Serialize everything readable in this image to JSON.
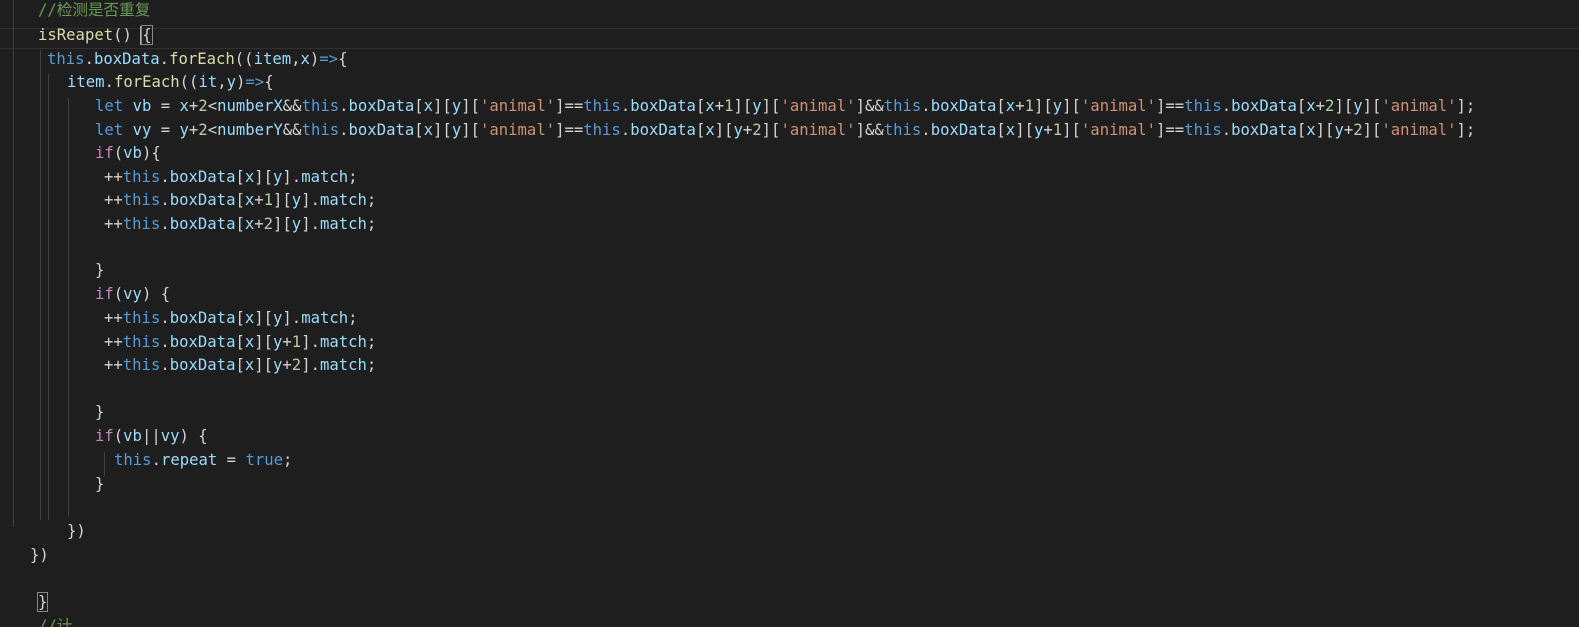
{
  "editor": {
    "lines": [
      {
        "name": "code-line-1",
        "tokens": [
          {
            "c": "cmt",
            "t": "//检测是否重复"
          }
        ]
      },
      {
        "name": "code-line-2",
        "tokens": [
          {
            "c": "fn",
            "t": "isReapet"
          },
          {
            "c": "pun",
            "t": "() "
          },
          {
            "c": "pun bracket-match",
            "t": "{"
          }
        ]
      },
      {
        "name": "code-line-3",
        "tokens": [
          {
            "c": "kw",
            "t": "this"
          },
          {
            "c": "pun",
            "t": "."
          },
          {
            "c": "var",
            "t": "boxData"
          },
          {
            "c": "pun",
            "t": "."
          },
          {
            "c": "fn",
            "t": "forEach"
          },
          {
            "c": "pun",
            "t": "(("
          },
          {
            "c": "var",
            "t": "item"
          },
          {
            "c": "pun",
            "t": ","
          },
          {
            "c": "var",
            "t": "x"
          },
          {
            "c": "pun",
            "t": ")"
          },
          {
            "c": "kw",
            "t": "=>"
          },
          {
            "c": "pun",
            "t": "{"
          }
        ]
      },
      {
        "name": "code-line-4",
        "tokens": [
          {
            "c": "var",
            "t": "item"
          },
          {
            "c": "pun",
            "t": "."
          },
          {
            "c": "fn",
            "t": "forEach"
          },
          {
            "c": "pun",
            "t": "(("
          },
          {
            "c": "var",
            "t": "it"
          },
          {
            "c": "pun",
            "t": ","
          },
          {
            "c": "var",
            "t": "y"
          },
          {
            "c": "pun",
            "t": ")"
          },
          {
            "c": "kw",
            "t": "=>"
          },
          {
            "c": "pun",
            "t": "{"
          }
        ]
      },
      {
        "name": "code-line-5",
        "tokens": [
          {
            "c": "kw",
            "t": "let"
          },
          {
            "c": "pun",
            "t": " "
          },
          {
            "c": "var",
            "t": "vb"
          },
          {
            "c": "pun",
            "t": " = "
          },
          {
            "c": "var",
            "t": "x"
          },
          {
            "c": "pun",
            "t": "+"
          },
          {
            "c": "num",
            "t": "2"
          },
          {
            "c": "pun",
            "t": "<"
          },
          {
            "c": "var",
            "t": "numberX"
          },
          {
            "c": "pun",
            "t": "&&"
          },
          {
            "c": "kw",
            "t": "this"
          },
          {
            "c": "pun",
            "t": "."
          },
          {
            "c": "var",
            "t": "boxData"
          },
          {
            "c": "pun",
            "t": "["
          },
          {
            "c": "var",
            "t": "x"
          },
          {
            "c": "pun",
            "t": "]["
          },
          {
            "c": "var",
            "t": "y"
          },
          {
            "c": "pun",
            "t": "]["
          },
          {
            "c": "str",
            "t": "'animal'"
          },
          {
            "c": "pun",
            "t": "]=="
          },
          {
            "c": "kw",
            "t": "this"
          },
          {
            "c": "pun",
            "t": "."
          },
          {
            "c": "var",
            "t": "boxData"
          },
          {
            "c": "pun",
            "t": "["
          },
          {
            "c": "var",
            "t": "x"
          },
          {
            "c": "pun",
            "t": "+"
          },
          {
            "c": "num",
            "t": "1"
          },
          {
            "c": "pun",
            "t": "]["
          },
          {
            "c": "var",
            "t": "y"
          },
          {
            "c": "pun",
            "t": "]["
          },
          {
            "c": "str",
            "t": "'animal'"
          },
          {
            "c": "pun",
            "t": "]&&"
          },
          {
            "c": "kw",
            "t": "this"
          },
          {
            "c": "pun",
            "t": "."
          },
          {
            "c": "var",
            "t": "boxData"
          },
          {
            "c": "pun",
            "t": "["
          },
          {
            "c": "var",
            "t": "x"
          },
          {
            "c": "pun",
            "t": "+"
          },
          {
            "c": "num",
            "t": "1"
          },
          {
            "c": "pun",
            "t": "]["
          },
          {
            "c": "var",
            "t": "y"
          },
          {
            "c": "pun",
            "t": "]["
          },
          {
            "c": "str",
            "t": "'animal'"
          },
          {
            "c": "pun",
            "t": "]=="
          },
          {
            "c": "kw",
            "t": "this"
          },
          {
            "c": "pun",
            "t": "."
          },
          {
            "c": "var",
            "t": "boxData"
          },
          {
            "c": "pun",
            "t": "["
          },
          {
            "c": "var",
            "t": "x"
          },
          {
            "c": "pun",
            "t": "+"
          },
          {
            "c": "num",
            "t": "2"
          },
          {
            "c": "pun",
            "t": "]["
          },
          {
            "c": "var",
            "t": "y"
          },
          {
            "c": "pun",
            "t": "]["
          },
          {
            "c": "str",
            "t": "'animal'"
          },
          {
            "c": "pun",
            "t": "];"
          }
        ]
      },
      {
        "name": "code-line-6",
        "tokens": [
          {
            "c": "kw",
            "t": "let"
          },
          {
            "c": "pun",
            "t": " "
          },
          {
            "c": "var",
            "t": "vy"
          },
          {
            "c": "pun",
            "t": " = "
          },
          {
            "c": "var",
            "t": "y"
          },
          {
            "c": "pun",
            "t": "+"
          },
          {
            "c": "num",
            "t": "2"
          },
          {
            "c": "pun",
            "t": "<"
          },
          {
            "c": "var",
            "t": "numberY"
          },
          {
            "c": "pun",
            "t": "&&"
          },
          {
            "c": "kw",
            "t": "this"
          },
          {
            "c": "pun",
            "t": "."
          },
          {
            "c": "var",
            "t": "boxData"
          },
          {
            "c": "pun",
            "t": "["
          },
          {
            "c": "var",
            "t": "x"
          },
          {
            "c": "pun",
            "t": "]["
          },
          {
            "c": "var",
            "t": "y"
          },
          {
            "c": "pun",
            "t": "]["
          },
          {
            "c": "str",
            "t": "'animal'"
          },
          {
            "c": "pun",
            "t": "]=="
          },
          {
            "c": "kw",
            "t": "this"
          },
          {
            "c": "pun",
            "t": "."
          },
          {
            "c": "var",
            "t": "boxData"
          },
          {
            "c": "pun",
            "t": "["
          },
          {
            "c": "var",
            "t": "x"
          },
          {
            "c": "pun",
            "t": "]["
          },
          {
            "c": "var",
            "t": "y"
          },
          {
            "c": "pun",
            "t": "+"
          },
          {
            "c": "num",
            "t": "2"
          },
          {
            "c": "pun",
            "t": "]["
          },
          {
            "c": "str",
            "t": "'animal'"
          },
          {
            "c": "pun",
            "t": "]&&"
          },
          {
            "c": "kw",
            "t": "this"
          },
          {
            "c": "pun",
            "t": "."
          },
          {
            "c": "var",
            "t": "boxData"
          },
          {
            "c": "pun",
            "t": "["
          },
          {
            "c": "var",
            "t": "x"
          },
          {
            "c": "pun",
            "t": "]["
          },
          {
            "c": "var",
            "t": "y"
          },
          {
            "c": "pun",
            "t": "+"
          },
          {
            "c": "num",
            "t": "1"
          },
          {
            "c": "pun",
            "t": "]["
          },
          {
            "c": "str",
            "t": "'animal'"
          },
          {
            "c": "pun",
            "t": "]=="
          },
          {
            "c": "kw",
            "t": "this"
          },
          {
            "c": "pun",
            "t": "."
          },
          {
            "c": "var",
            "t": "boxData"
          },
          {
            "c": "pun",
            "t": "["
          },
          {
            "c": "var",
            "t": "x"
          },
          {
            "c": "pun",
            "t": "]["
          },
          {
            "c": "var",
            "t": "y"
          },
          {
            "c": "pun",
            "t": "+"
          },
          {
            "c": "num",
            "t": "2"
          },
          {
            "c": "pun",
            "t": "]["
          },
          {
            "c": "str",
            "t": "'animal'"
          },
          {
            "c": "pun",
            "t": "];"
          }
        ]
      },
      {
        "name": "code-line-7",
        "tokens": [
          {
            "c": "kw2",
            "t": "if"
          },
          {
            "c": "pun",
            "t": "("
          },
          {
            "c": "var",
            "t": "vb"
          },
          {
            "c": "pun",
            "t": "){"
          }
        ]
      },
      {
        "name": "code-line-8",
        "tokens": [
          {
            "c": "pun",
            "t": "++"
          },
          {
            "c": "kw",
            "t": "this"
          },
          {
            "c": "pun",
            "t": "."
          },
          {
            "c": "var",
            "t": "boxData"
          },
          {
            "c": "pun",
            "t": "["
          },
          {
            "c": "var",
            "t": "x"
          },
          {
            "c": "pun",
            "t": "]["
          },
          {
            "c": "var",
            "t": "y"
          },
          {
            "c": "pun",
            "t": "]."
          },
          {
            "c": "var",
            "t": "match"
          },
          {
            "c": "pun",
            "t": ";"
          }
        ]
      },
      {
        "name": "code-line-9",
        "tokens": [
          {
            "c": "pun",
            "t": "++"
          },
          {
            "c": "kw",
            "t": "this"
          },
          {
            "c": "pun",
            "t": "."
          },
          {
            "c": "var",
            "t": "boxData"
          },
          {
            "c": "pun",
            "t": "["
          },
          {
            "c": "var",
            "t": "x"
          },
          {
            "c": "pun",
            "t": "+"
          },
          {
            "c": "num",
            "t": "1"
          },
          {
            "c": "pun",
            "t": "]["
          },
          {
            "c": "var",
            "t": "y"
          },
          {
            "c": "pun",
            "t": "]."
          },
          {
            "c": "var",
            "t": "match"
          },
          {
            "c": "pun",
            "t": ";"
          }
        ]
      },
      {
        "name": "code-line-10",
        "tokens": [
          {
            "c": "pun",
            "t": "++"
          },
          {
            "c": "kw",
            "t": "this"
          },
          {
            "c": "pun",
            "t": "."
          },
          {
            "c": "var",
            "t": "boxData"
          },
          {
            "c": "pun",
            "t": "["
          },
          {
            "c": "var",
            "t": "x"
          },
          {
            "c": "pun",
            "t": "+"
          },
          {
            "c": "num",
            "t": "2"
          },
          {
            "c": "pun",
            "t": "]["
          },
          {
            "c": "var",
            "t": "y"
          },
          {
            "c": "pun",
            "t": "]."
          },
          {
            "c": "var",
            "t": "match"
          },
          {
            "c": "pun",
            "t": ";"
          }
        ]
      },
      {
        "name": "code-line-11",
        "tokens": []
      },
      {
        "name": "code-line-12",
        "tokens": [
          {
            "c": "pun",
            "t": "}"
          }
        ]
      },
      {
        "name": "code-line-13",
        "tokens": [
          {
            "c": "kw2",
            "t": "if"
          },
          {
            "c": "pun",
            "t": "("
          },
          {
            "c": "var",
            "t": "vy"
          },
          {
            "c": "pun",
            "t": ") {"
          }
        ]
      },
      {
        "name": "code-line-14",
        "tokens": [
          {
            "c": "pun",
            "t": "++"
          },
          {
            "c": "kw",
            "t": "this"
          },
          {
            "c": "pun",
            "t": "."
          },
          {
            "c": "var",
            "t": "boxData"
          },
          {
            "c": "pun",
            "t": "["
          },
          {
            "c": "var",
            "t": "x"
          },
          {
            "c": "pun",
            "t": "]["
          },
          {
            "c": "var",
            "t": "y"
          },
          {
            "c": "pun",
            "t": "]."
          },
          {
            "c": "var",
            "t": "match"
          },
          {
            "c": "pun",
            "t": ";"
          }
        ]
      },
      {
        "name": "code-line-15",
        "tokens": [
          {
            "c": "pun",
            "t": "++"
          },
          {
            "c": "kw",
            "t": "this"
          },
          {
            "c": "pun",
            "t": "."
          },
          {
            "c": "var",
            "t": "boxData"
          },
          {
            "c": "pun",
            "t": "["
          },
          {
            "c": "var",
            "t": "x"
          },
          {
            "c": "pun",
            "t": "]["
          },
          {
            "c": "var",
            "t": "y"
          },
          {
            "c": "pun",
            "t": "+"
          },
          {
            "c": "num",
            "t": "1"
          },
          {
            "c": "pun",
            "t": "]."
          },
          {
            "c": "var",
            "t": "match"
          },
          {
            "c": "pun",
            "t": ";"
          }
        ]
      },
      {
        "name": "code-line-16",
        "tokens": [
          {
            "c": "pun",
            "t": "++"
          },
          {
            "c": "kw",
            "t": "this"
          },
          {
            "c": "pun",
            "t": "."
          },
          {
            "c": "var",
            "t": "boxData"
          },
          {
            "c": "pun",
            "t": "["
          },
          {
            "c": "var",
            "t": "x"
          },
          {
            "c": "pun",
            "t": "]["
          },
          {
            "c": "var",
            "t": "y"
          },
          {
            "c": "pun",
            "t": "+"
          },
          {
            "c": "num",
            "t": "2"
          },
          {
            "c": "pun",
            "t": "]."
          },
          {
            "c": "var",
            "t": "match"
          },
          {
            "c": "pun",
            "t": ";"
          }
        ]
      },
      {
        "name": "code-line-17",
        "tokens": []
      },
      {
        "name": "code-line-18",
        "tokens": [
          {
            "c": "pun",
            "t": "}"
          }
        ]
      },
      {
        "name": "code-line-19",
        "tokens": [
          {
            "c": "kw2",
            "t": "if"
          },
          {
            "c": "pun",
            "t": "("
          },
          {
            "c": "var",
            "t": "vb"
          },
          {
            "c": "pun",
            "t": "||"
          },
          {
            "c": "var",
            "t": "vy"
          },
          {
            "c": "pun",
            "t": ") {"
          }
        ]
      },
      {
        "name": "code-line-20",
        "tokens": [
          {
            "c": "kw",
            "t": "this"
          },
          {
            "c": "pun",
            "t": "."
          },
          {
            "c": "var",
            "t": "repeat"
          },
          {
            "c": "pun",
            "t": " = "
          },
          {
            "c": "kw",
            "t": "true"
          },
          {
            "c": "pun",
            "t": ";"
          }
        ]
      },
      {
        "name": "code-line-21",
        "tokens": [
          {
            "c": "pun",
            "t": "}"
          }
        ]
      },
      {
        "name": "code-line-22",
        "tokens": []
      },
      {
        "name": "code-line-23",
        "tokens": [
          {
            "c": "pun",
            "t": "})"
          }
        ]
      },
      {
        "name": "code-line-24",
        "tokens": [
          {
            "c": "pun",
            "t": "})"
          }
        ]
      },
      {
        "name": "code-line-25",
        "tokens": []
      },
      {
        "name": "code-line-26",
        "tokens": [
          {
            "c": "pun bracket-match",
            "t": "}"
          }
        ]
      },
      {
        "name": "code-line-27",
        "tokens": [
          {
            "c": "cmt",
            "t": "//计"
          }
        ]
      }
    ]
  },
  "theme": {
    "background": "#1e1e1e",
    "keyword": "#569cd6",
    "control": "#c586c0",
    "function": "#dcdcaa",
    "variable": "#9cdcfe",
    "string": "#ce9178",
    "number": "#b5cea8",
    "comment": "#6a9955"
  }
}
